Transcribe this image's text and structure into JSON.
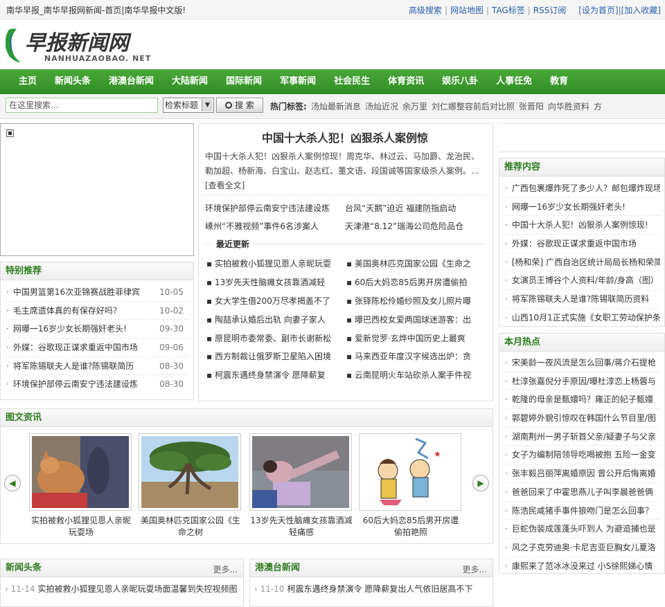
{
  "topbar": {
    "site_title": "南华早报_南华早报网新闻-首页|南华早报中文版!",
    "links": [
      "高级搜索",
      "网站地图",
      "TAG标签",
      "RSS订阅"
    ],
    "set_home": "[设为首页]",
    "add_fav": "[加入收藏]"
  },
  "logo": {
    "cn": "早报新闻网",
    "en": "NANHUAZAOBAO. NET"
  },
  "nav": [
    "主页",
    "新闻头条",
    "港澳台新闻",
    "大陆新闻",
    "国际新闻",
    "军事新闻",
    "社会民生",
    "体育资讯",
    "娱乐八卦",
    "人事任免",
    "教育"
  ],
  "search": {
    "placeholder": "在这里搜索...",
    "select": "检索标题",
    "button": "搜 索",
    "hot_label": "热门标签:",
    "hot_tags": [
      "汤灿最新消息",
      "汤灿近况",
      "余万里",
      "刘仁娜整容前后对比照",
      "张晋阳",
      "向华胜资料",
      "方"
    ]
  },
  "special": {
    "title": "特别推荐",
    "items": [
      {
        "title": "中国男篮第16次亚锦赛战胜菲律宾",
        "date": "10-05"
      },
      {
        "title": "毛主席遗体真的有保存好吗？",
        "date": "10-02"
      },
      {
        "title": "网曝一16岁少女长期强奸老头!",
        "date": "09-30"
      },
      {
        "title": "外媒：谷歌现正谋求重返中国市场",
        "date": "09-06"
      },
      {
        "title": "将军陈锡联夫人是谁?陈锡联简历",
        "date": "08-30"
      },
      {
        "title": "环境保护部停云南安宁违法建设炼",
        "date": "08-30"
      }
    ]
  },
  "feature": {
    "title": "中国十大杀人犯！凶狠杀人案例惊",
    "desc": "中国十大杀人犯！凶狠杀人案例惊现！周克华、林过云、马加爵、龙治民、勒加超、杨新海、白宝山、赵志红、董文语、段国诚等国家级杀人案例。...",
    "more": "[查看全文]",
    "pairs": [
      [
        "环境保护部停云南安宁违法建设炼",
        "台风“天鹅”迫近 福建防指启动"
      ],
      [
        "嵊州“不雅视频”事件6名涉案人",
        "天津港“8.12”瑞海公司危险品仓"
      ]
    ]
  },
  "recent": {
    "title": "最近更新",
    "left": [
      "实拍被救小狐狸见恩人亲昵玩耍",
      "13岁先天性脑瘫女孩靠酒减轻",
      "女大学生借200万尽孝揭盖不了",
      "陶喆承认婚后出轨 向妻子家人",
      "原昆明市委常委、副市长谢新松",
      "西方制裁让俄罗斯卫星陷入困境",
      "柯震东遇终身禁演令 愿降薪复"
    ],
    "right": [
      "美国奥林匹克国家公园《生命之",
      "60后大妈恋85后男开房遭偷拍",
      "张铎陈松伶婚纱照及女儿照片曝",
      "曝巴西校女爱两国球迷游客：出",
      "爱新觉罗·玄烨中国历史上最爽",
      "马来西亚年度汉字候选出炉：贪",
      "云南昆明火车站砍杀人案手件视"
    ]
  },
  "recommend": {
    "title": "推荐内容",
    "items": [
      "广西包裹爆炸死了多少人？邮包爆炸现场",
      "网曝一16岁少女长期强奸老头!",
      "中国十大杀人犯！凶狠杀人案例惊现!",
      "外媒：谷歌现正谋求重返中国市场",
      "[杨和荣] 广西自治区统计局局长杨和荣简",
      "女演员王博谷个人资料/年龄/身高（图）",
      "将军陈锡联夫人是谁?陈锡联简历资料",
      "山西10月1正式实施《女职工劳动保护条"
    ]
  },
  "hot": {
    "title": "本月热点",
    "items": [
      "宋美龄一夜风流是怎么回事/蒋介石提枪",
      "杜淳张嘉倪分手原因/曝杜淳恋上杨蓉与",
      "乾隆的母亲是甄嬛吗？雍正的妃子甄嬛",
      "郭碧婷外貌引惊叹在韩国什么节目里/图",
      "湖南荆州一男子斩首父亲/疑妻子与父亲",
      "女子为编制陪领导吃喝被抱 五险一金变",
      "张丰毅吕丽萍离婚原因 曾公开后悔离婚",
      "爸爸回来了中霍思燕儿子叫李晨爸爸俩",
      "陈浩民咸猪手事件狼吻门是怎么回事？",
      "巨蛇伪装成莲蓬头吓到人 为避追捕也是",
      "风之子克劳迪奥·卡尼吉亚巨胸女儿夏洛",
      "康熙来了范冰冰没来过 小S徐熙娣心情"
    ]
  },
  "gallery": {
    "title": "图文资讯",
    "captions": [
      "实拍被救小狐狸见恩人亲昵玩耍场",
      "美国奥林匹克国家公园《生命之树",
      "13岁先天性脑瘫女孩靠酒减轻痛感",
      "60后大妈恋85后男开房遭偷拍艳照"
    ]
  },
  "news_headline": {
    "title": "新闻头条",
    "more": "更多...",
    "item": {
      "date": "11-14",
      "title": "实拍被救小狐狸见恩人亲昵玩耍场面温馨到失控视频图"
    }
  },
  "hk_news": {
    "title": "港澳台新闻",
    "more": "更多...",
    "item": {
      "date": "11-10",
      "title": "柯震东遇终身禁演令 愿降薪复出人气依旧居高不下"
    }
  },
  "colors": {
    "nav_green": "#2f8d22",
    "heading_green": "#2e7d1f",
    "link_blue": "#2a5fa8"
  }
}
